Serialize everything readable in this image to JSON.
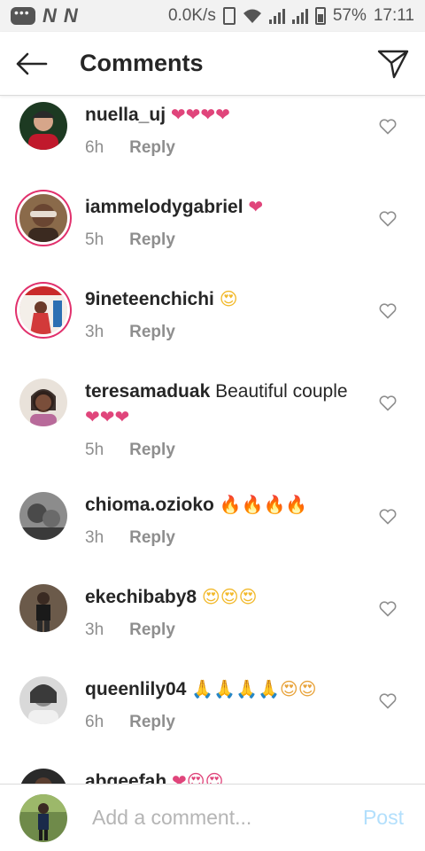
{
  "status_bar": {
    "carrier_icons": [
      "N",
      "N"
    ],
    "speed": "0.0K/s",
    "battery": "57%",
    "time": "17:11"
  },
  "header": {
    "title": "Comments",
    "back_icon": "arrow-left-icon",
    "send_icon": "paper-plane-icon"
  },
  "comments": [
    {
      "username": "nuella_uj",
      "text": "",
      "emoji": "❤❤❤❤",
      "emoji_kind": "heart",
      "time": "6h",
      "reply": "Reply"
    },
    {
      "username": "iammelodygabriel",
      "text": "",
      "emoji": "❤",
      "emoji_kind": "heart",
      "time": "5h",
      "reply": "Reply"
    },
    {
      "username": "9ineteenchichi",
      "text": "",
      "emoji": "😍",
      "emoji_kind": "smile",
      "time": "3h",
      "reply": "Reply"
    },
    {
      "username": "teresamaduak",
      "text": "Beautiful couple",
      "emoji": "❤❤❤",
      "emoji_kind": "heart",
      "time": "5h",
      "reply": "Reply"
    },
    {
      "username": "chioma.ozioko",
      "text": "",
      "emoji": "🔥🔥🔥🔥",
      "emoji_kind": "fire",
      "time": "3h",
      "reply": "Reply"
    },
    {
      "username": "ekechibaby8",
      "text": "",
      "emoji": "😍😍😍",
      "emoji_kind": "smile",
      "time": "3h",
      "reply": "Reply"
    },
    {
      "username": "queenlily04",
      "text": "",
      "emoji": "🙏🙏🙏🙏😍😍",
      "emoji_kind": "pray",
      "time": "6h",
      "reply": "Reply"
    },
    {
      "username": "abgeefah",
      "text": "",
      "emoji": "❤😍😍",
      "emoji_kind": "heart",
      "time": "",
      "reply": ""
    }
  ],
  "composer": {
    "placeholder": "Add a comment...",
    "post_label": "Post"
  },
  "colors": {
    "heart": "#e0457b",
    "post_disabled": "#b2dffc",
    "meta_gray": "#8e8e8e"
  }
}
